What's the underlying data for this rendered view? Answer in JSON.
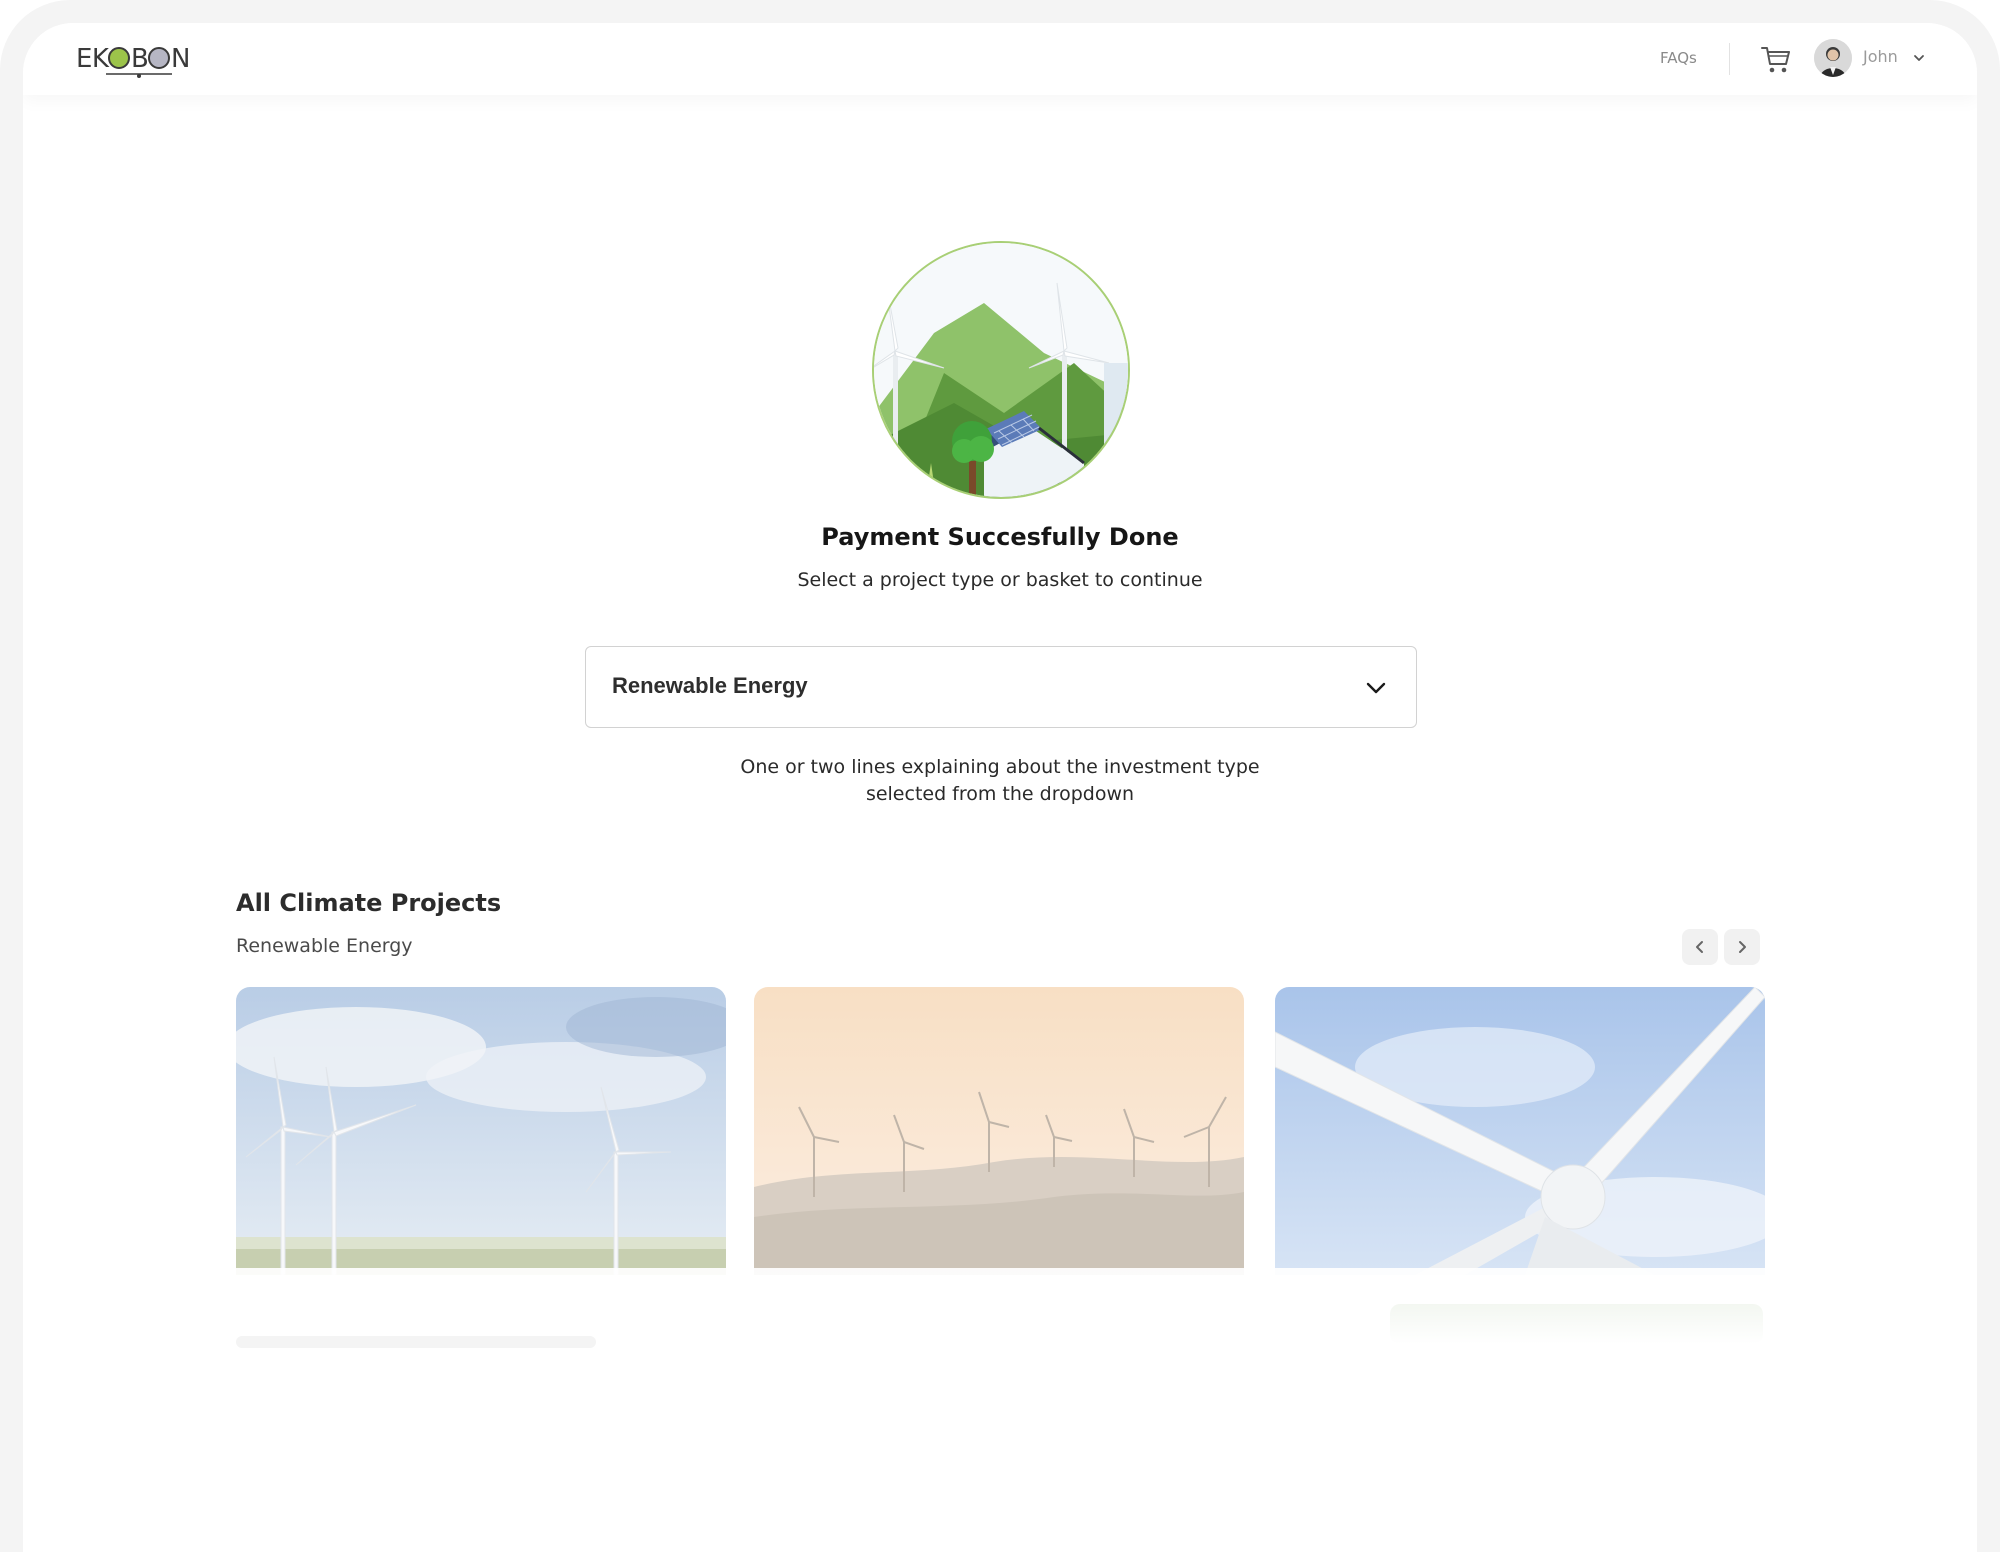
{
  "header": {
    "logo_text": "EKOBON",
    "faqs_label": "FAQs",
    "cart_icon": "shopping-cart-icon",
    "user_name": "John",
    "user_menu_icon": "chevron-down-icon"
  },
  "hero": {
    "title": "Payment Succesfully Done",
    "subtitle": "Select a project type or basket to continue"
  },
  "project_selector": {
    "selected_value": "Renewable Energy",
    "help_text": "One or two lines explaining about the investment type selected from the dropdown"
  },
  "projects_section": {
    "title": "All Climate Projects",
    "category": "Renewable Energy",
    "prev_icon": "chevron-left-icon",
    "next_icon": "chevron-right-icon"
  },
  "colors": {
    "accent_green": "#a8cf75",
    "text_dark": "#161616",
    "text_muted": "#8a8a8a"
  }
}
